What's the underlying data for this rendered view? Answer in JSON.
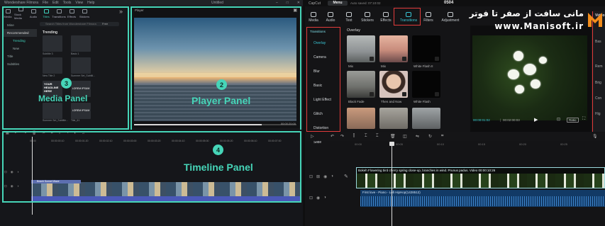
{
  "filmora": {
    "title": "Wondershare Filmora",
    "menu": [
      "File",
      "Edit",
      "Tools",
      "View",
      "Help"
    ],
    "project_name": "Untitled",
    "tabs": [
      {
        "label": "Media",
        "active": false
      },
      {
        "label": "Stock Media",
        "active": false
      },
      {
        "label": "Audio",
        "active": false
      },
      {
        "label": "Titles",
        "active": true
      },
      {
        "label": "Transitions",
        "active": false
      },
      {
        "label": "Effects",
        "active": false
      },
      {
        "label": "Stickers",
        "active": false
      }
    ],
    "sidebar": [
      "Mine",
      "Recommended",
      "Trending",
      "New",
      "Title",
      "Subtitles"
    ],
    "search_placeholder": "Search Titles from Wondershare Filmora",
    "filter_label": "Free",
    "section_heading": "Trending",
    "thumbnails": [
      "Subtitle 3",
      "Basic 1",
      "New Title 2",
      "Summer Set_Subtitl...",
      "YOUR HEADLINE HERE",
      "LOREM IPSUM",
      "LOREM IPSUM",
      "Summer Set_Subtitle...",
      "Title_61"
    ],
    "player": {
      "label": "Player",
      "time": "00:00:20:00",
      "quality": "Full Quality"
    },
    "ruler": [
      "00:00",
      "00:00:00:10",
      "00:00:01:20",
      "00:00:02:10",
      "00:00:03:00",
      "00:00:03:20",
      "00:00:04:10",
      "00:00:05:00",
      "00:00:05:20",
      "00:00:06:10",
      "00:00:07:00",
      "00:00:08:00"
    ],
    "clip_label": "Beach Sunset Wave",
    "annotations": {
      "media": {
        "number": "3",
        "label": "Media Panel"
      },
      "player": {
        "number": "2",
        "label": "Player Panel"
      },
      "timeline": {
        "number": "4",
        "label": "Timeline Panel"
      }
    },
    "accent": "#46d5b8"
  },
  "capcut": {
    "app_name": "CapCut",
    "menu_label": "Menu",
    "autosave": "Auto saved: 07:10:02",
    "project_name": "0504",
    "tabs": [
      {
        "label": "Media",
        "active": false
      },
      {
        "label": "Audio",
        "active": false
      },
      {
        "label": "Text",
        "active": false
      },
      {
        "label": "Stickers",
        "active": false
      },
      {
        "label": "Effects",
        "active": false
      },
      {
        "label": "Transitions",
        "active": true
      },
      {
        "label": "Filters",
        "active": false
      },
      {
        "label": "Adjustment",
        "active": false
      }
    ],
    "transition_categories": [
      "Transitions",
      "Overlay",
      "Camera",
      "Blur",
      "Basic",
      "Light Effect",
      "Glitch",
      "Distortion",
      "Slide"
    ],
    "section_heading": "Overlay",
    "transitions": [
      "Mix",
      "Mix",
      "White Flash II",
      "Black Fade",
      "Then and Now",
      "White Flash"
    ],
    "player": {
      "current": "00:00:01:02",
      "total": "00:02:00:03",
      "ratio": "Ratio"
    },
    "right_panel": [
      "Video",
      "Bas",
      "Rem",
      "Brig",
      "Con",
      "Hig"
    ],
    "ruler": [
      "00:00",
      "00:05",
      "00:10",
      "00:15",
      "00:20",
      "00:25",
      "00:30"
    ],
    "video_clip": "Bokeh  Flowering bird cherry spring close-up, branches in wind. Prunus padus. Video  00:00:10:26",
    "audio_clip": "First love - Piano - Lofi HipHop(1428512)",
    "accent": "#39c6d6",
    "highlight": "#e23b3b"
  },
  "watermark": {
    "arabic": "مانی سافت از صفر تا فوتر",
    "latin": "www.Manisoft.ir"
  }
}
